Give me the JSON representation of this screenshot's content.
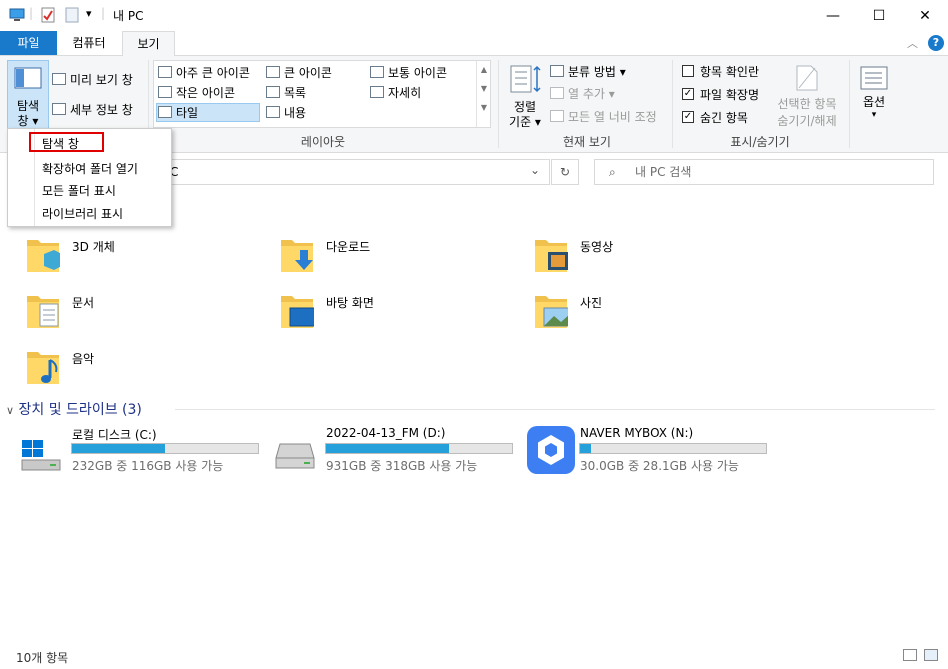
{
  "window": {
    "title": "내 PC",
    "minimize_glyph": "—",
    "maximize_glyph": "☐",
    "close_glyph": "✕",
    "separator": "|"
  },
  "tabs": [
    {
      "label": "파일",
      "active": false
    },
    {
      "label": "컴퓨터",
      "active": false
    },
    {
      "label": "보기",
      "active": true
    }
  ],
  "ribbon": {
    "panes": {
      "nav_pane_label_1": "탐색",
      "nav_pane_label_2": "창 ▾",
      "preview_pane": "미리 보기 창",
      "details_pane": "세부 정보 창"
    },
    "layout": {
      "group_label": "레이아웃",
      "items": [
        "아주 큰 아이콘",
        "큰 아이콘",
        "보통 아이콘",
        "작은 아이콘",
        "목록",
        "자세히",
        "타일",
        "내용"
      ]
    },
    "current_view": {
      "group_label": "현재 보기",
      "sort_label_1": "정렬",
      "sort_label_2": "기준 ▾",
      "group_by": "분류 방법 ▾",
      "add_column": "열 추가 ▾",
      "size_all_columns": "모든 열 너비 조정"
    },
    "show_hide": {
      "group_label": "표시/숨기기",
      "item_checkboxes": {
        "label": "항목 확인란",
        "checked": false
      },
      "file_extensions": {
        "label": "파일 확장명",
        "checked": true
      },
      "hidden_items": {
        "label": "숨긴 항목",
        "checked": true
      },
      "hide_selected_1": "선택한 항목",
      "hide_selected_2": "숨기기/해제"
    },
    "options": {
      "label": "옵션",
      "arrow": "▾"
    }
  },
  "navpane_menu": {
    "items": [
      "탐색 창",
      "확장하여 폴더 열기",
      "모든 폴더 표시",
      "라이브러리 표시"
    ]
  },
  "address": {
    "visible_text": "C",
    "refresh_glyph": "↻",
    "dropdown_glyph": "⌄",
    "search_placeholder": "내 PC 검색"
  },
  "folders": [
    {
      "name": "3D 개체"
    },
    {
      "name": "다운로드"
    },
    {
      "name": "동영상"
    },
    {
      "name": "문서"
    },
    {
      "name": "바탕 화면"
    },
    {
      "name": "사진"
    },
    {
      "name": "음악"
    }
  ],
  "devices": {
    "header": "장치 및 드라이브 (3)",
    "drives": [
      {
        "name": "로컬 디스크 (C:)",
        "space": "232GB 중 116GB 사용 가능",
        "used_fraction": 0.5
      },
      {
        "name": "2022-04-13_FM (D:)",
        "space": "931GB 중 318GB 사용 가능",
        "used_fraction": 0.66
      },
      {
        "name": "NAVER MYBOX (N:)",
        "space": "30.0GB 중 28.1GB 사용 가능",
        "used_fraction": 0.06
      }
    ]
  },
  "status": {
    "item_count": "10개 항목"
  },
  "colors": {
    "accent": "#1979ca",
    "selection": "#cce4f7",
    "bar": "#26a0da",
    "highlight_box": "#e00000"
  }
}
